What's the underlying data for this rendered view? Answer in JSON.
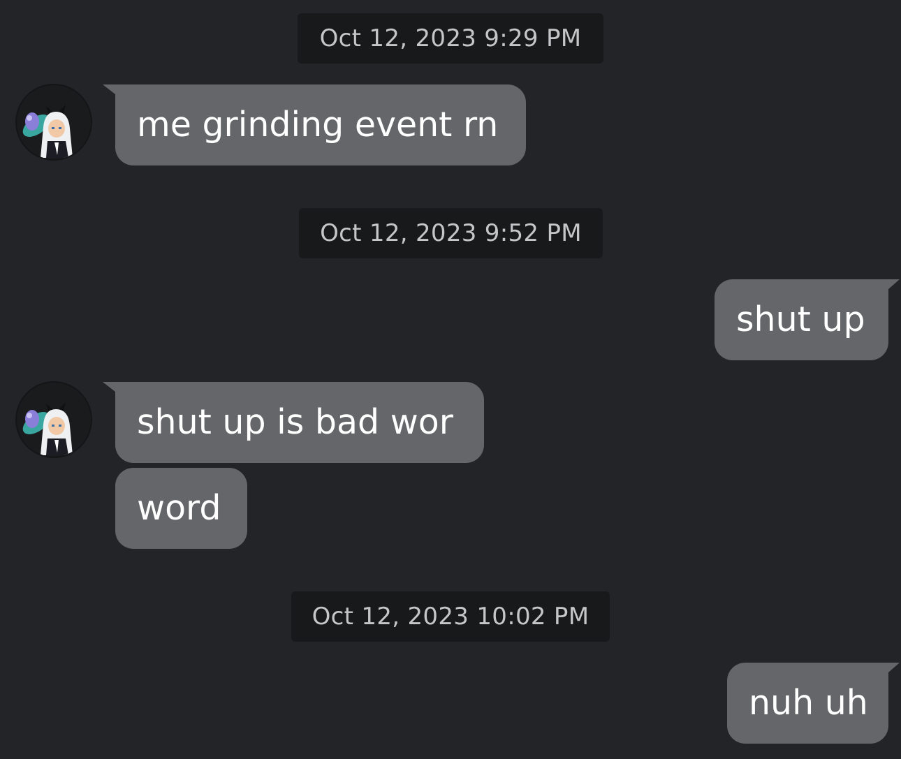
{
  "conversation": {
    "timestamps": [
      "Oct 12, 2023 9:29 PM",
      "Oct 12, 2023 9:52 PM",
      "Oct 12, 2023 10:02 PM"
    ],
    "messages": [
      {
        "sender": "them",
        "text": "me grinding event rn"
      },
      {
        "sender": "me",
        "text": "shut up"
      },
      {
        "sender": "them",
        "text": "shut up is bad wor"
      },
      {
        "sender": "them",
        "text": "word"
      },
      {
        "sender": "me",
        "text": "nuh uh"
      }
    ],
    "avatar_icon": "roblox-avatar-icon"
  },
  "colors": {
    "background": "#232427",
    "timestamp_bg": "#18191b",
    "bubble_bg": "#65666a",
    "text": "#ffffff"
  }
}
